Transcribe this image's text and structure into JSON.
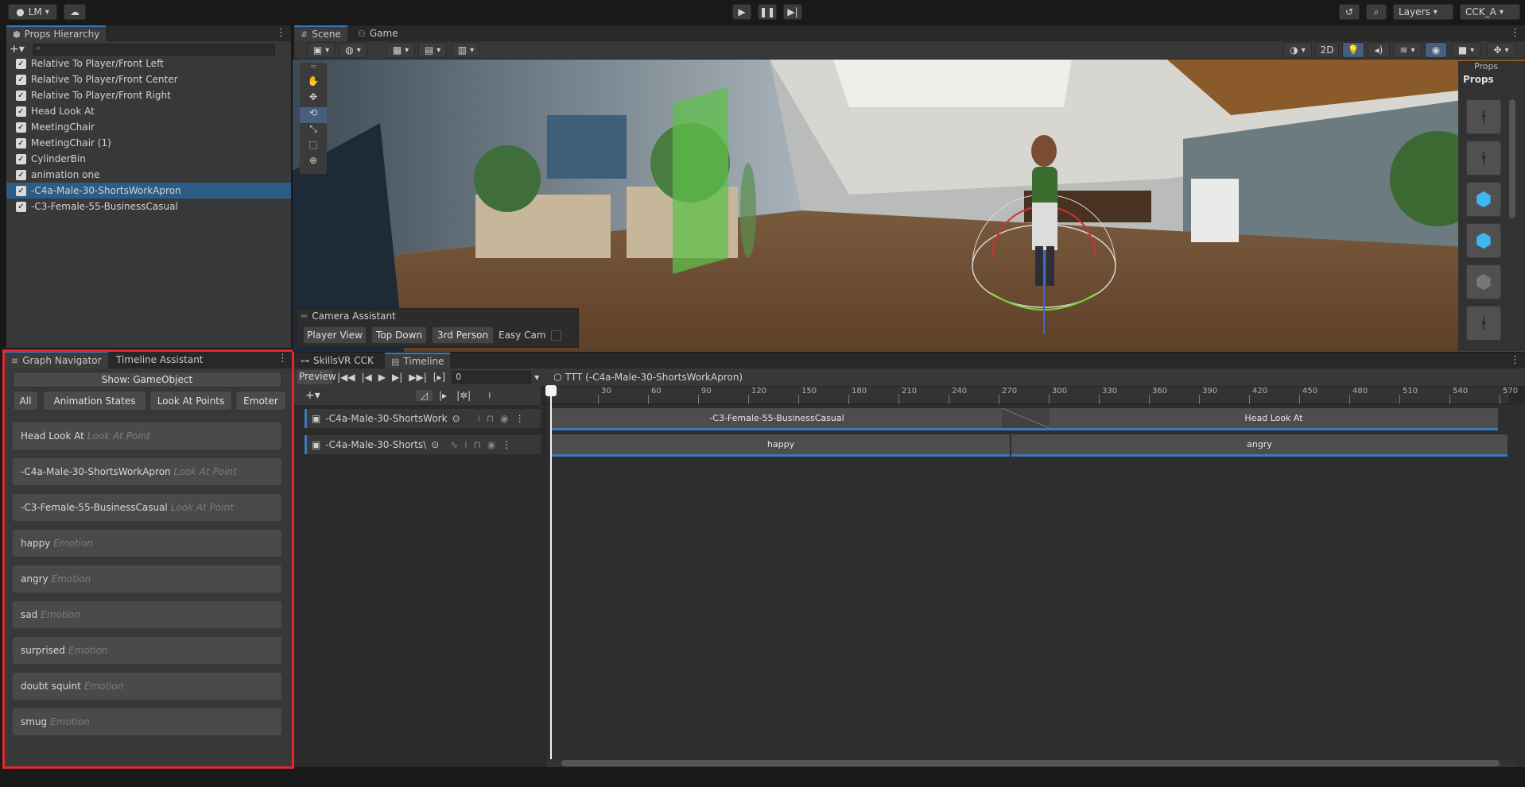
{
  "topbar": {
    "account_label": "LM",
    "layers_label": "Layers",
    "layout_label": "CCK_A"
  },
  "hierarchy": {
    "tab_label": "Props Hierarchy",
    "items": [
      {
        "label": "Relative To Player/Front Left"
      },
      {
        "label": "Relative To Player/Front Center"
      },
      {
        "label": "Relative To Player/Front Right"
      },
      {
        "label": "Head Look At"
      },
      {
        "label": "MeetingChair"
      },
      {
        "label": "MeetingChair (1)"
      },
      {
        "label": "CylinderBin"
      },
      {
        "label": "animation one"
      },
      {
        "label": "-C4a-Male-30-ShortsWorkApron"
      },
      {
        "label": "-C3-Female-55-BusinessCasual"
      }
    ]
  },
  "scene": {
    "tab_scene": "Scene",
    "tab_game": "Game",
    "btn_2d": "2D",
    "camera_assistant": {
      "title": "Camera Assistant",
      "buttons": [
        "Player View",
        "Top Down",
        "3rd Person"
      ],
      "easy_cam_label": "Easy Cam"
    },
    "props_overlay": {
      "title": "Props",
      "header": "Props"
    }
  },
  "graph_navigator": {
    "tab_label": "Graph Navigator",
    "tab_timeline_assistant": "Timeline Assistant",
    "show_label": "Show: GameObject",
    "filters": [
      "All",
      "Animation States",
      "Look At Points",
      "Emoter"
    ],
    "items": [
      {
        "name": "Head Look At",
        "type": "Look At Point"
      },
      {
        "name": "-C4a-Male-30-ShortsWorkApron",
        "type": "Look At Point"
      },
      {
        "name": "-C3-Female-55-BusinessCasual",
        "type": "Look At Point"
      },
      {
        "name": "happy",
        "type": "Emotion"
      },
      {
        "name": "angry",
        "type": "Emotion"
      },
      {
        "name": "sad",
        "type": "Emotion"
      },
      {
        "name": "surprised",
        "type": "Emotion"
      },
      {
        "name": "doubt squint",
        "type": "Emotion"
      },
      {
        "name": "smug",
        "type": "Emotion"
      }
    ]
  },
  "timeline": {
    "tab_skills": "SkillsVR CCK",
    "tab_timeline": "Timeline",
    "preview_label": "Preview",
    "frame_value": "0",
    "asset_label": "TTT (-C4a-Male-30-ShortsWorkApron)",
    "ruler_ticks": [
      "30",
      "60",
      "90",
      "120",
      "150",
      "180",
      "210",
      "240",
      "270",
      "300",
      "330",
      "360",
      "390",
      "420",
      "450",
      "480",
      "510",
      "540",
      "570"
    ],
    "tracks": [
      {
        "label": "-C4a-Male-30-ShortsWork",
        "clips": [
          "-C3-Female-55-BusinessCasual",
          "Head Look At"
        ]
      },
      {
        "label": "-C4a-Male-30-Shorts\\",
        "clips": [
          "happy",
          "angry"
        ]
      }
    ]
  },
  "colors": {
    "accent": "#3a79bb",
    "highlight_outline": "#e0282e"
  }
}
